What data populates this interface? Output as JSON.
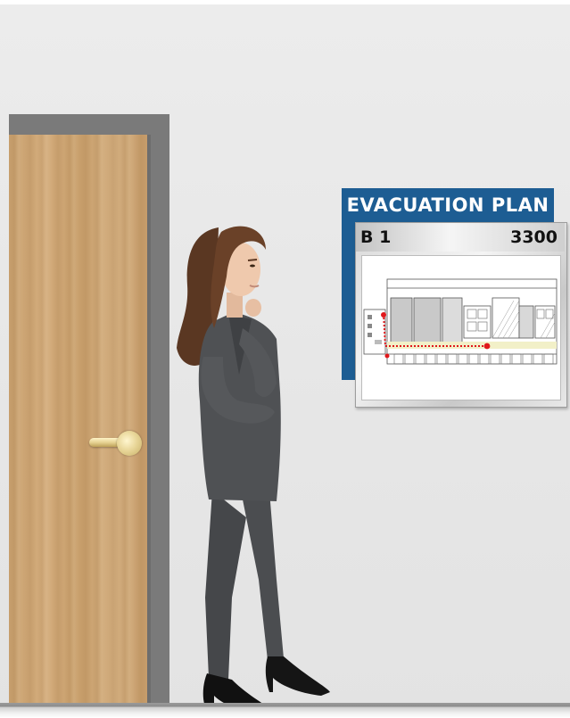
{
  "sign": {
    "title": "EVACUATION PLAN",
    "level": "B 1",
    "room": "3300",
    "colors": {
      "header_blue": "#1d5d93",
      "route_red": "#e0181b"
    }
  },
  "colors": {
    "wall": "#e6e6e6",
    "door_frame": "#7a7a7a",
    "door_wood": "#cda575",
    "handle_brass": "#e3cf8e",
    "suit": "#4b4d50"
  }
}
